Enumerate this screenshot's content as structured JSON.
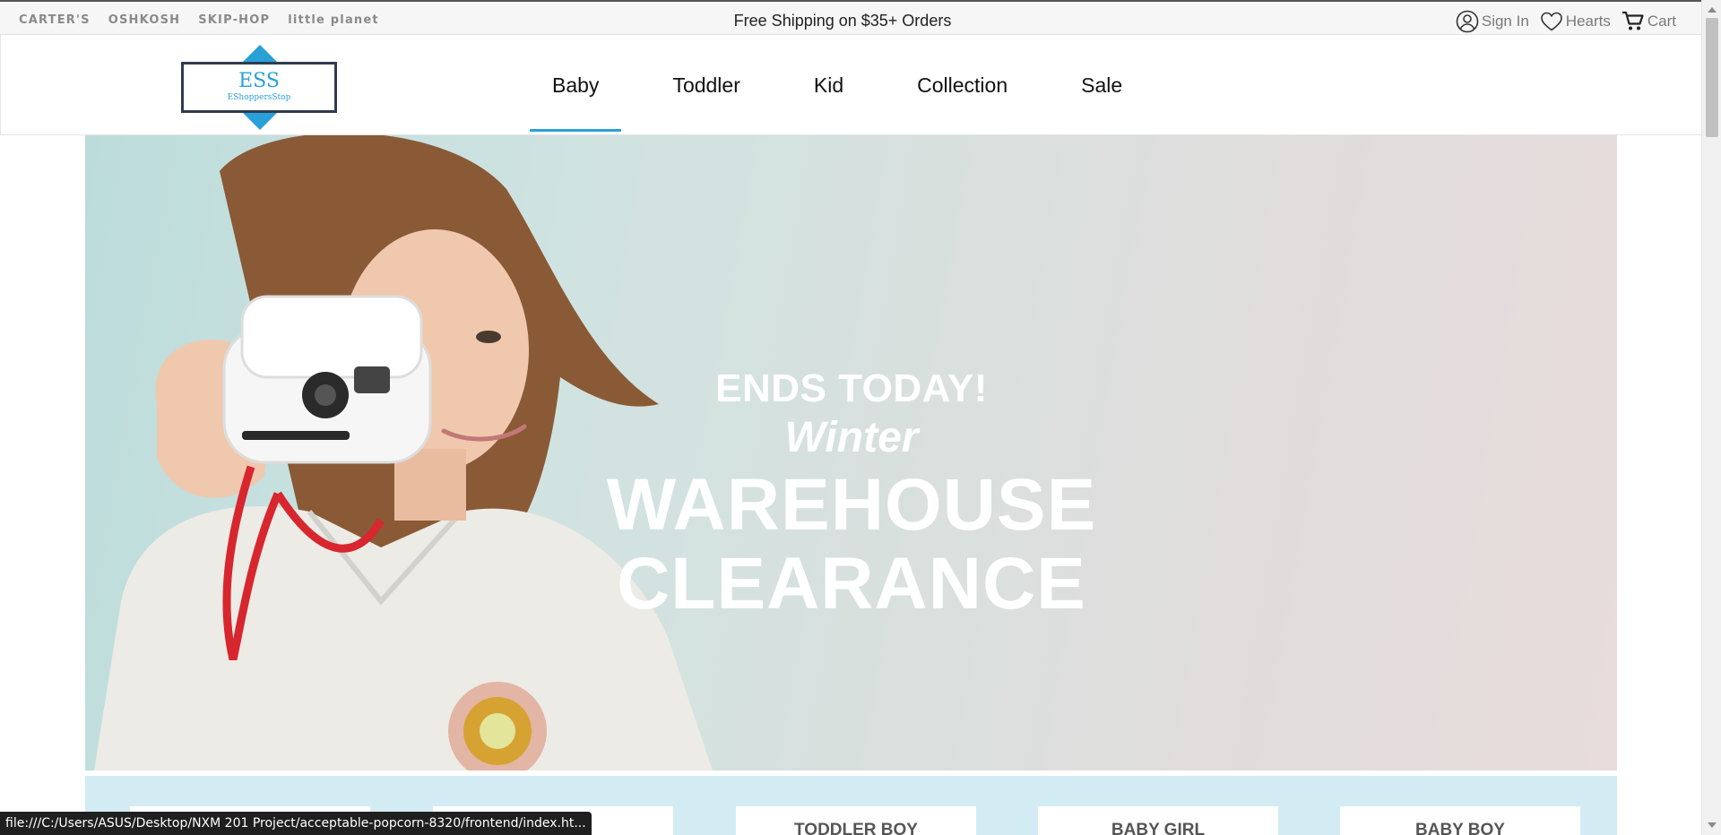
{
  "topbar": {
    "brands": [
      "CARTER'S",
      "OSHKOSH",
      "SKIP-HOP",
      "little planet"
    ],
    "promo": "Free Shipping on $35+ Orders",
    "account": {
      "sign_in": "Sign In",
      "hearts": "Hearts",
      "cart": "Cart"
    }
  },
  "logo": {
    "title": "ESS",
    "subtitle": "EShoppersStop"
  },
  "nav": {
    "items": [
      "Baby",
      "Toddler",
      "Kid",
      "Collection",
      "Sale"
    ],
    "active": "Baby"
  },
  "hero": {
    "line1": "ENDS TODAY!",
    "line2": "Winter",
    "line3": "WAREHOUSE",
    "line4": "CLEARANCE"
  },
  "categories": [
    "",
    "",
    "TODDLER BOY",
    "BABY GIRL",
    "BABY BOY"
  ],
  "status_bar": "file:///C:/Users/ASUS/Desktop/NXM 201 Project/acceptable-popcorn-8320/frontend/index.ht...",
  "colors": {
    "accent": "#2aa0d8",
    "logo_border": "#2f3b4f",
    "category_strip": "#d3ecf4"
  },
  "icons": {
    "sign_in": "user-circle-icon",
    "hearts": "heart-icon",
    "cart": "cart-icon"
  }
}
